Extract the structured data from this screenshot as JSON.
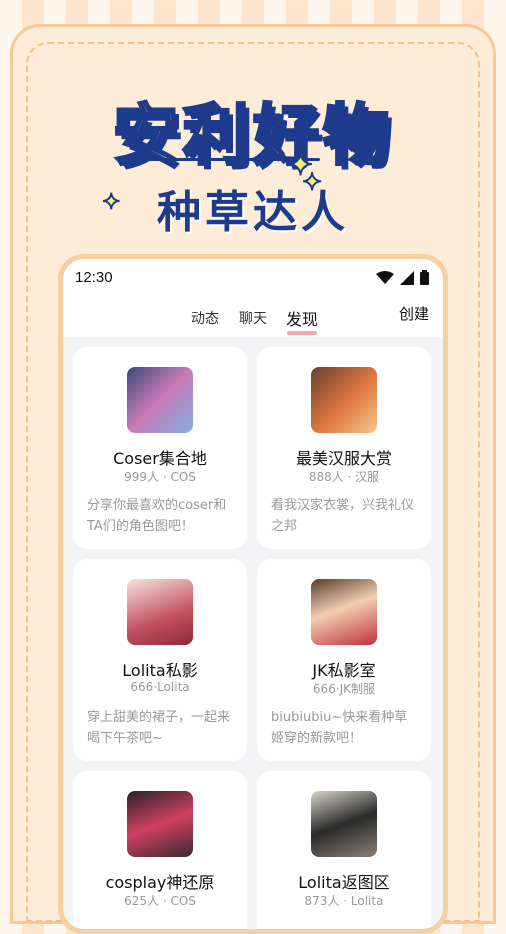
{
  "promo": {
    "headline": "安利好物",
    "subheadline": "种草达人"
  },
  "status_bar": {
    "time": "12:30",
    "icons": [
      "wifi-icon",
      "signal-icon",
      "battery-icon"
    ]
  },
  "tabs": [
    {
      "label": "动态"
    },
    {
      "label": "聊天"
    },
    {
      "label": "发现",
      "active": true
    }
  ],
  "create_label": "创建",
  "cards": [
    {
      "title": "Coser集合地",
      "meta": "999人 · COS",
      "desc": "分享你最喜欢的coser和TA们的角色图吧！"
    },
    {
      "title": "最美汉服大赏",
      "meta": "888人 · 汉服",
      "desc": "看我汉家衣裳，兴我礼仪之邦"
    },
    {
      "title": "Lolita私影",
      "meta": "666·Lolita",
      "desc": "穿上甜美的裙子，一起来喝下午茶吧~"
    },
    {
      "title": "JK私影室",
      "meta": "666·JK制服",
      "desc": "biubiubiu~快来看种草姬穿的新款吧！"
    },
    {
      "title": "cosplay神还原",
      "meta": "625人 · COS",
      "desc": ""
    },
    {
      "title": "Lolita返图区",
      "meta": "873人 · Lolita",
      "desc": ""
    }
  ],
  "colors": {
    "headline_fill": "#fff06a",
    "headline_stroke": "#1d3a8c",
    "tab_indicator": "#f2a9b2",
    "frame_border": "#f5c99a"
  }
}
